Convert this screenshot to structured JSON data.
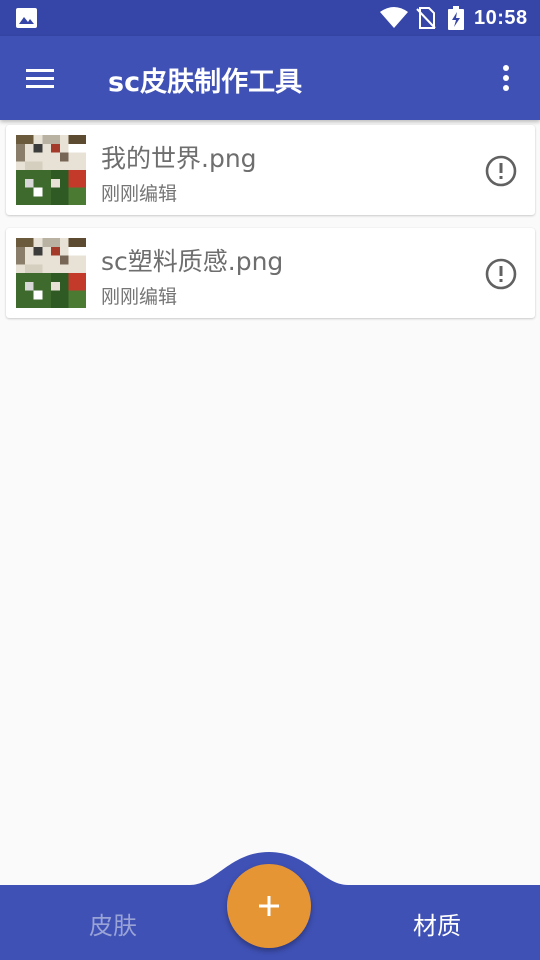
{
  "status_bar": {
    "time": "10:58",
    "icons": [
      "image-icon",
      "wifi-icon",
      "no-sim-icon",
      "battery-charging-icon"
    ]
  },
  "app_bar": {
    "title": "sc皮肤制作工具",
    "icons": [
      "menu-icon",
      "more-vertical-icon"
    ]
  },
  "files": [
    {
      "name": "我的世界.png",
      "status": "刚刚编辑",
      "icon": "alert-circle-icon"
    },
    {
      "name": "sc塑料质感.png",
      "status": "刚刚编辑",
      "icon": "alert-circle-icon"
    }
  ],
  "bottom_nav": {
    "tab_left": "皮肤",
    "tab_right": "材质",
    "fab_icon": "plus-icon",
    "colors": {
      "bar": "#3f51b5",
      "fab": "#e69535",
      "active": "#ffffff",
      "inactive": "#9aa3d6"
    }
  }
}
